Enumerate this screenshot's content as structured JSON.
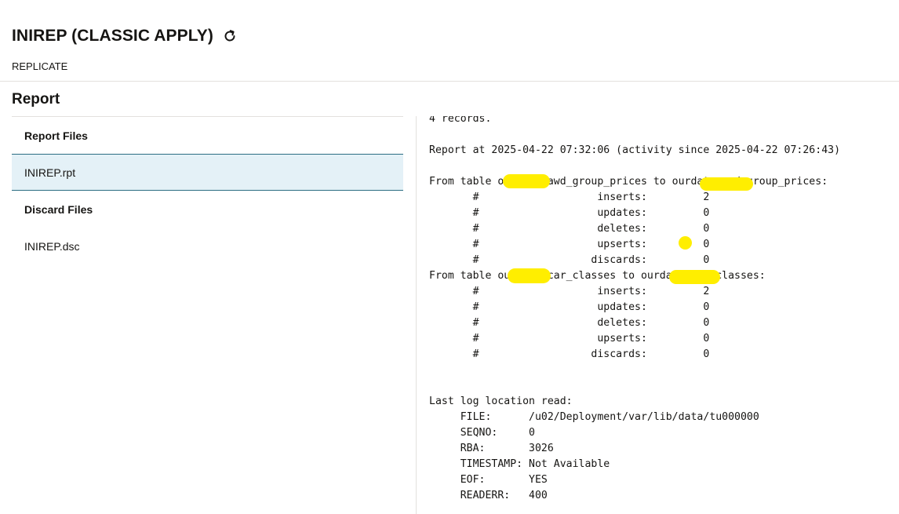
{
  "header": {
    "title": "INIREP (CLASSIC APPLY)",
    "refresh_icon": "refresh-icon",
    "subtitle": "REPLICATE"
  },
  "section": {
    "title": "Report"
  },
  "report_files": {
    "header": "Report Files",
    "items": [
      {
        "label": "INIREP.rpt",
        "selected": true
      }
    ]
  },
  "discard_files": {
    "header": "Discard Files",
    "items": [
      {
        "label": "INIREP.dsc",
        "selected": false
      }
    ]
  },
  "report_lines": [
    "4 records.",
    "",
    "Report at 2025-04-22 07:32:06 (activity since 2025-04-22 07:26:43)",
    "",
    "From table ourdata.awd_group_prices to ourdata.awd_group_prices:",
    "       #                   inserts:         2",
    "       #                   updates:         0",
    "       #                   deletes:         0",
    "       #                   upserts:         0",
    "       #                  discards:         0",
    "From table ourdata.car_classes to ourdata.car_classes:",
    "       #                   inserts:         2",
    "       #                   updates:         0",
    "       #                   deletes:         0",
    "       #                   upserts:         0",
    "       #                  discards:         0",
    "",
    "",
    "Last log location read:",
    "     FILE:      /u02/Deployment/var/lib/data/tu000000",
    "     SEQNO:     0",
    "     RBA:       3026",
    "     TIMESTAMP: Not Available",
    "     EOF:       YES",
    "     READERR:   400"
  ],
  "colors": {
    "accent": "#2b6d83",
    "selected_bg": "#e4f1f7",
    "redaction": "#ffee00"
  }
}
